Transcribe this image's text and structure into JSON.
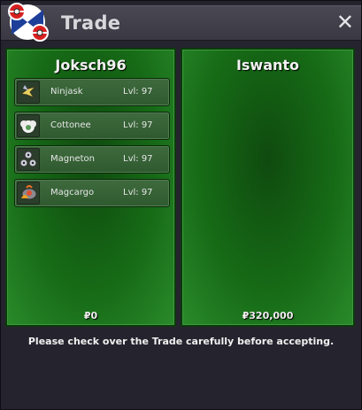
{
  "window": {
    "title": "Trade",
    "close_glyph": "✕"
  },
  "left_panel": {
    "player_name": "Joksch96",
    "money": "₽0",
    "items": [
      {
        "name": "Ninjask",
        "level": "Lvl: 97",
        "icon": "ninjask-icon"
      },
      {
        "name": "Cottonee",
        "level": "Lvl: 97",
        "icon": "cottonee-icon"
      },
      {
        "name": "Magneton",
        "level": "Lvl: 97",
        "icon": "magneton-icon"
      },
      {
        "name": "Magcargo",
        "level": "Lvl: 97",
        "icon": "magcargo-icon"
      }
    ]
  },
  "right_panel": {
    "player_name": "Iswanto",
    "money": "₽320,000",
    "items": []
  },
  "footer": {
    "notice": "Please check over the Trade carefully before accepting."
  },
  "colors": {
    "panel_green": "#166a16",
    "window_bg": "#25232d",
    "titlebar": "#423f4a"
  }
}
